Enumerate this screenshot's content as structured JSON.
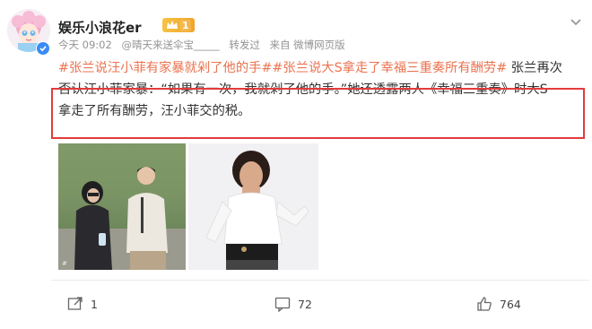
{
  "user": {
    "name": "娱乐小浪花er",
    "level": "1"
  },
  "meta": {
    "time": "今天 09:02",
    "mention": "@晴天来送伞宝_____",
    "repost_label": "转发过",
    "source": "来自 微博网页版"
  },
  "post": {
    "tag1": "#张兰说汪小菲有家暴就剁了他的手#",
    "tag2": "#张兰说大S拿走了幸福三重奏所有酬劳#",
    "line1_tail": "张兰再次",
    "line2": "否认汪小菲家暴：“如果有一次，我就剁了他的手。”她还透露两人《幸福三重奏》时大S",
    "line3": "拿走了所有酬劳，汪小菲交的税。"
  },
  "actions": {
    "repost_count": "1",
    "comment_count": "72",
    "like_count": "764"
  },
  "colors": {
    "topic": "#eb7350",
    "highlight_box": "#e23c3c",
    "badge_gold": "#f0a42b",
    "verified_blue": "#3a8cf3"
  },
  "icons": [
    "more-icon",
    "crown-icon",
    "verified-icon",
    "repost-icon",
    "comment-icon",
    "like-icon"
  ]
}
